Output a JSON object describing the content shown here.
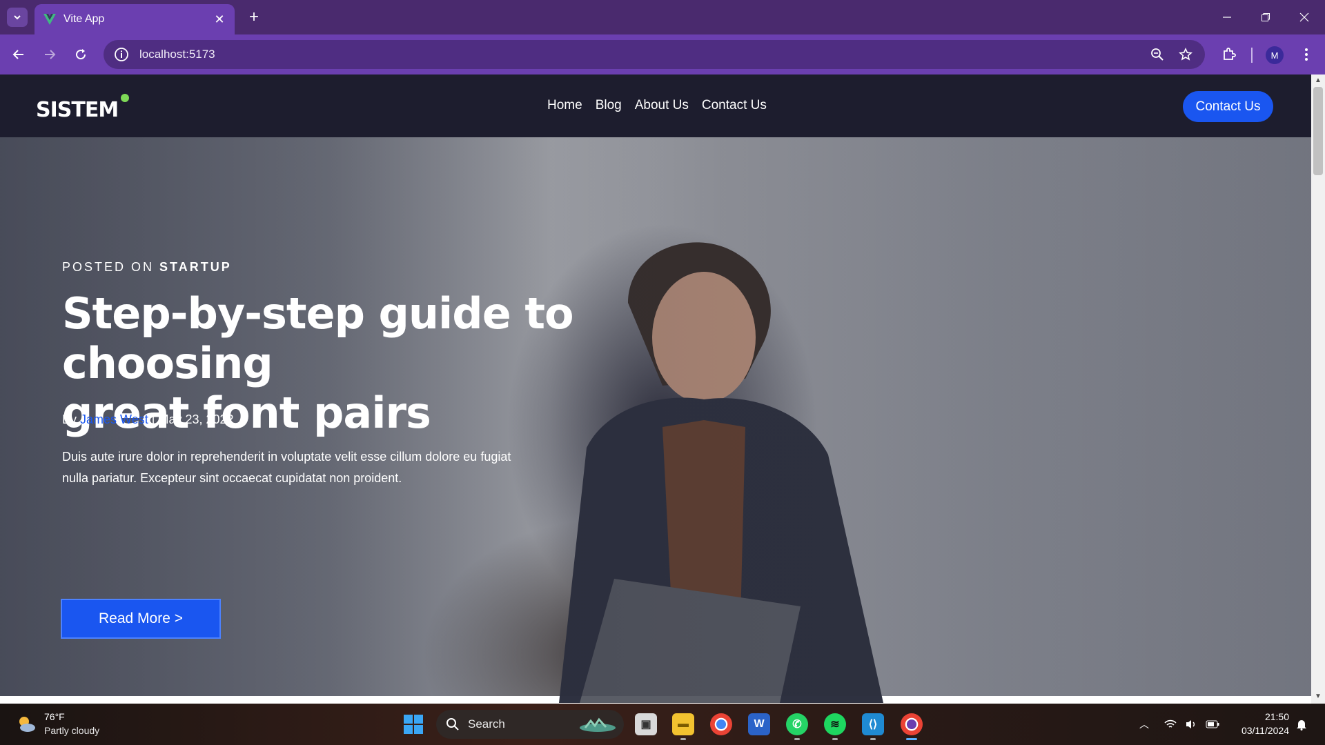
{
  "browser": {
    "tab_title": "Vite App",
    "url": "localhost:5173",
    "profile_initial": "M"
  },
  "site": {
    "brand": "SISTEM",
    "nav": [
      "Home",
      "Blog",
      "About Us",
      "Contact Us"
    ],
    "cta_label": "Contact Us"
  },
  "hero": {
    "posted_prefix": "POSTED ON",
    "category": "STARTUP",
    "title_line1": "Step-by-step guide to choosing",
    "title_line2": "great font pairs",
    "by_label": "By",
    "author": "James West",
    "separator": "|",
    "date": "May 23, 2022",
    "excerpt": "Duis aute irure dolor in reprehenderit in voluptate velit esse cillum dolore eu fugiat nulla pariatur. Excepteur sint occaecat cupidatat non proident.",
    "button_label": "Read More >"
  },
  "taskbar": {
    "temperature": "76°F",
    "weather": "Partly cloudy",
    "search_label": "Search",
    "time": "21:50",
    "date": "03/11/2024",
    "apps": [
      "task-view-icon",
      "file-explorer-icon",
      "chrome-icon",
      "word-icon",
      "whatsapp-icon",
      "spotify-icon",
      "vscode-icon",
      "chrome-profile-icon"
    ]
  },
  "colors": {
    "browser_frame": "#6b3fb0",
    "site_nav_bg": "#1d1d2e",
    "accent_blue": "#1a56f0",
    "brand_dot": "#7ed957"
  }
}
